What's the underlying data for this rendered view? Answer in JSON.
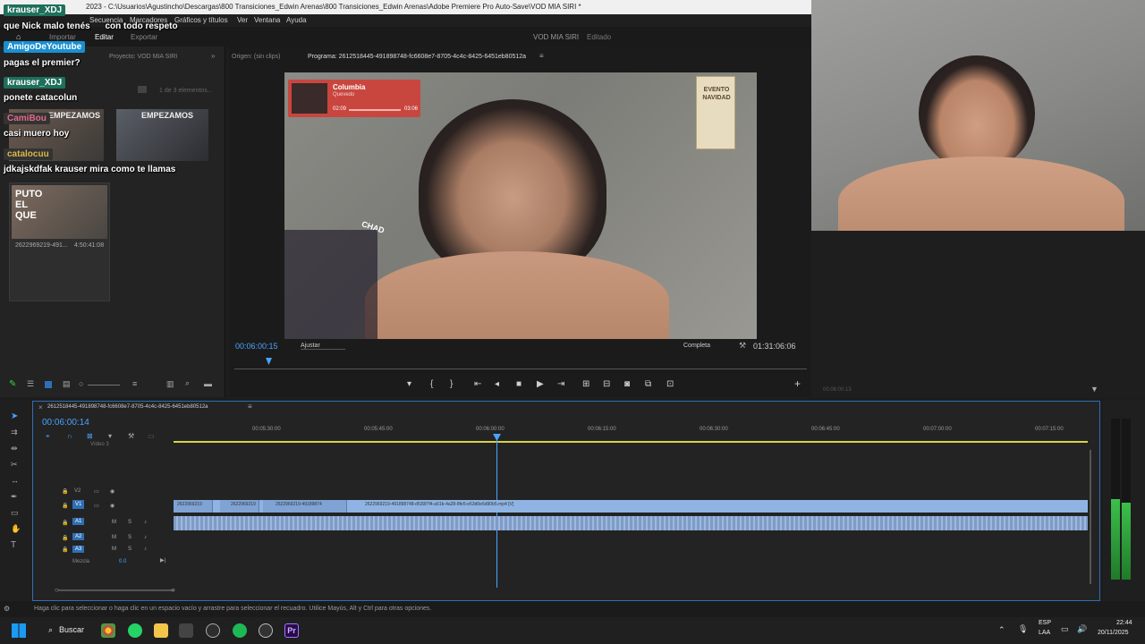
{
  "window": {
    "title": "2023 - C:\\Usuarios\\Agustincho\\Descargas\\800 Transiciones_Edwin Arenas\\800 Transiciones_Edwin Arenas\\Adobe Premiere Pro Auto-Save\\VOD MIA SIRI *"
  },
  "menu": {
    "items": [
      "Secuencia",
      "Marcadores",
      "Gráficos y títulos",
      "Ver",
      "Ventana",
      "Ayuda"
    ]
  },
  "workspace": {
    "tabs": [
      "Importar",
      "Editar",
      "Exportar"
    ],
    "project_title": "VOD MIA SIRI",
    "status": "Editado"
  },
  "chat": [
    {
      "user": "krauser_XDJ",
      "user_color": "#1e6f5c",
      "message": "que Nick malo tenés",
      "extra": "con todo respeto"
    },
    {
      "user": "AmigoDeYoutube",
      "user_color": "#1a8fd0",
      "message": "pagas el premier?"
    },
    {
      "user": "krauser_XDJ",
      "user_color": "#1e6f5c",
      "message": "ponete catacolun"
    },
    {
      "user": "CamiBou",
      "user_color": "#e26a8a",
      "message": "casi muero hoy"
    },
    {
      "user": "catalocuu",
      "user_color": "#d9b84a",
      "message": "jdkajskdfak krauser mira como te llamas"
    }
  ],
  "project_panel": {
    "tab_label": "Proyecto: VOD MIA SIRI",
    "items_count": "1 de 3 elementos...",
    "clips": [
      {
        "name": "2622969219-491...",
        "duration": "4:50:41:08",
        "overlay": "PUTO EL QUE"
      }
    ],
    "clip_top_label": "EMPEZAMOS",
    "clip_right_label": "EMPEZAMOS"
  },
  "source_panel": {
    "label": "Origen: (sin clips)"
  },
  "program_panel": {
    "label": "Programa: 2612518445-491898748-fc6608e7-8705-4c4c-8425-6451eb80512a",
    "timecode": "00:06:00:15",
    "fit": "Ajustar",
    "quality": "Completa",
    "duration": "01:31:06:06"
  },
  "video_overlay": {
    "music_title": "Columbia",
    "music_artist": "Quevedo",
    "music_time_start": "02:09",
    "music_time_end": "03:06",
    "poster_text": "EVENTO NAVIDAD",
    "chad_label": "CHAD"
  },
  "right_panel": {
    "timecode": "00:06:00:13"
  },
  "timeline": {
    "sequence_name": "2612518445-491898748-fc6608e7-8705-4c4c-8425-6451eb80512a",
    "timecode": "00:06:00:14",
    "ruler": [
      "00:05:30:00",
      "00:05:45:00",
      "00:06:00:00",
      "00:06:15:00",
      "00:06:30:00",
      "00:06:45:00",
      "00:07:00:00",
      "00:07:15:00"
    ],
    "tracks": [
      "V2",
      "V1",
      "A1",
      "A2",
      "A3"
    ],
    "video_label": "Vídeo 3",
    "mix_label": "Mezcla",
    "mix_value": "0.0",
    "clip_main": "2622969219-491898748-d530f7f4-a51b-4a28-8fe5-e53d0e6d90b5.mp4 [V]",
    "clip_small_1": "2622969219",
    "clip_small_2": "2622969219",
    "clip_small_3": "2622969219-49189874"
  },
  "status": {
    "hint": "Haga clic para seleccionar o haga clic en un espacio vacío y arrastre para seleccionar el recuadro. Utilice Mayús, Alt y Ctrl para otras opciones."
  },
  "taskbar": {
    "search": "Buscar",
    "lang1": "ESP",
    "lang2": "LAA",
    "time": "22:44",
    "date": "20/11/2025"
  },
  "colors": {
    "accent": "#2f6fb5",
    "timecode": "#4aa3ff",
    "clip_video": "#8fb4e3",
    "clip_audio": "#7e9cc8",
    "playhead": "#4aa3ff"
  }
}
